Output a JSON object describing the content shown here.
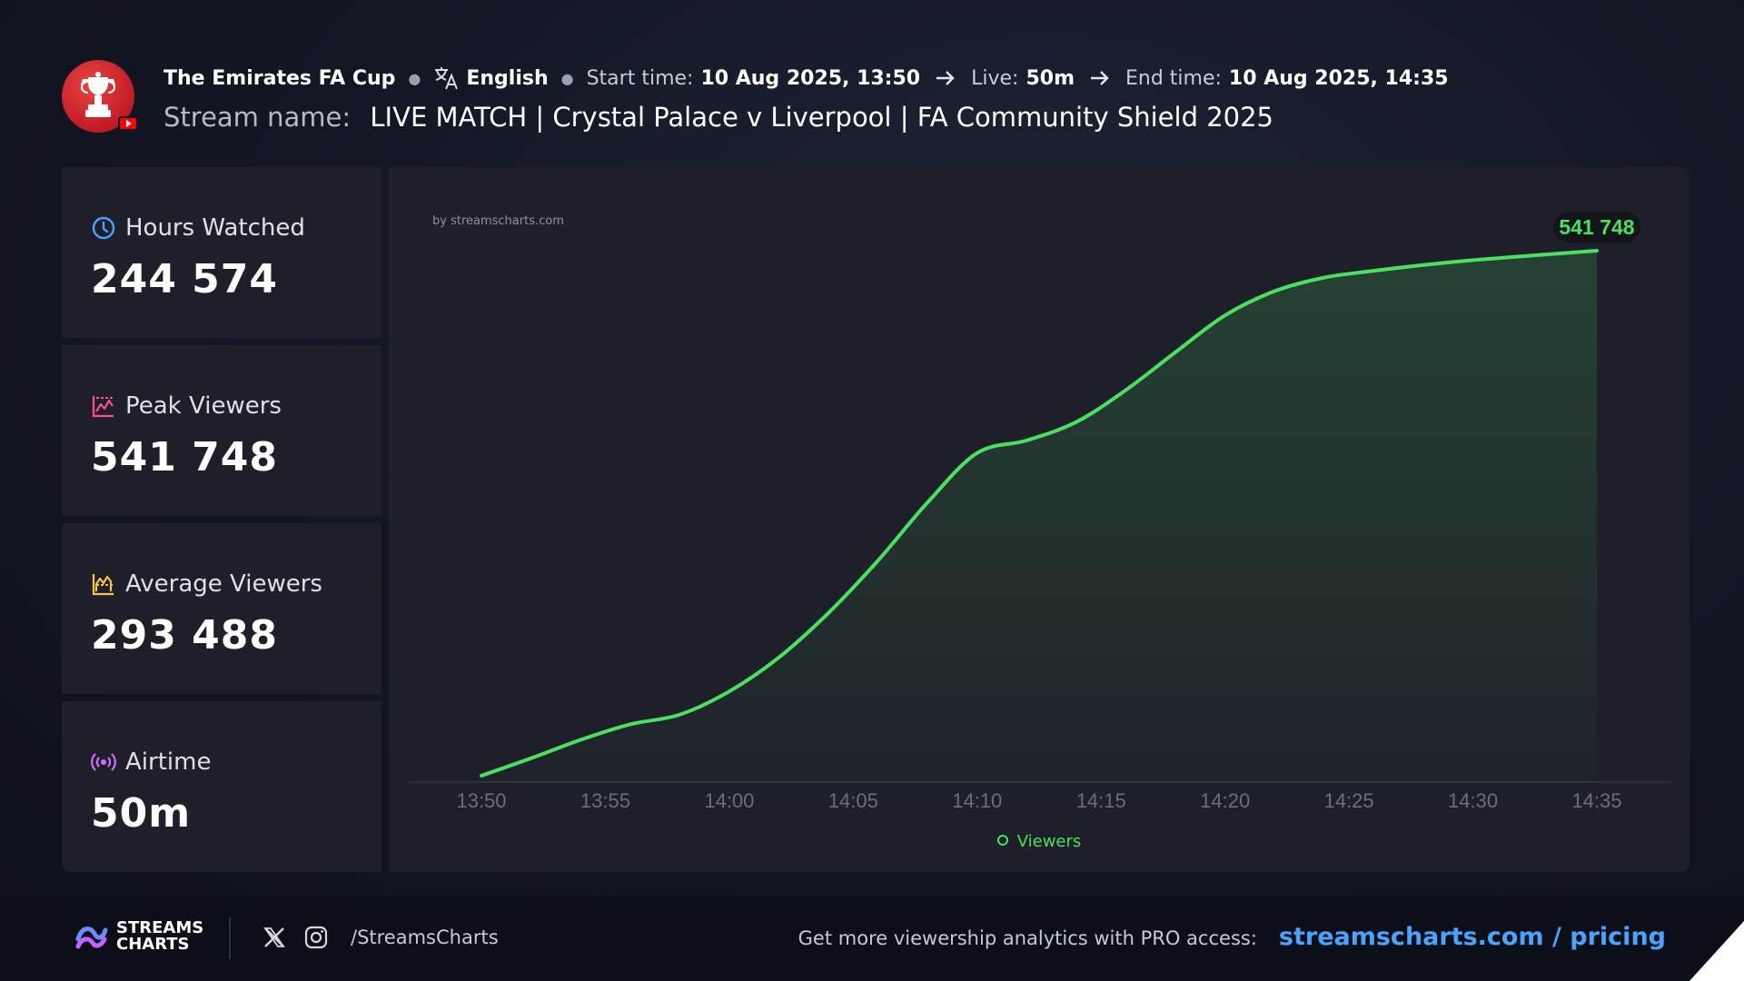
{
  "header": {
    "channel": "The Emirates FA Cup",
    "language": "English",
    "start_label": "Start time:",
    "start_value": "10 Aug 2025, 13:50",
    "live_label": "Live:",
    "live_value": "50m",
    "end_label": "End time:",
    "end_value": "10 Aug 2025, 14:35",
    "stream_label": "Stream name:",
    "stream_value": "LIVE MATCH | Crystal Palace v Liverpool | FA Community Shield 2025"
  },
  "stats": {
    "hours_watched": {
      "label": "Hours Watched",
      "value": "244 574",
      "icon": "clock-icon",
      "color": "#4aa3ff"
    },
    "peak_viewers": {
      "label": "Peak Viewers",
      "value": "541 748",
      "icon": "peak-chart-icon",
      "color": "#ff4d8d"
    },
    "average_viewers": {
      "label": "Average Viewers",
      "value": "293 488",
      "icon": "average-chart-icon",
      "color": "#f5c542"
    },
    "airtime": {
      "label": "Airtime",
      "value": "50m",
      "icon": "broadcast-icon",
      "color": "#d36bff"
    }
  },
  "chart_data": {
    "type": "area",
    "watermark": "by streamscharts.com",
    "x": [
      "13:50",
      "13:52",
      "13:54",
      "13:56",
      "13:58",
      "14:00",
      "14:02",
      "14:04",
      "14:06",
      "14:08",
      "14:10",
      "14:12",
      "14:14",
      "14:16",
      "14:18",
      "14:20",
      "14:22",
      "14:24",
      "14:26",
      "14:28",
      "14:30",
      "14:32",
      "14:35"
    ],
    "series": [
      {
        "name": "Viewers",
        "color": "#4ce063",
        "values": [
          0,
          18000,
          37000,
          53000,
          63000,
          87000,
          122000,
          168000,
          222000,
          282000,
          333000,
          346000,
          365000,
          398000,
          437000,
          475000,
          500000,
          514000,
          521000,
          527000,
          532000,
          536000,
          541748
        ]
      }
    ],
    "peak_label": "541 748",
    "xticks": [
      "13:50",
      "13:55",
      "14:00",
      "14:05",
      "14:10",
      "14:15",
      "14:20",
      "14:25",
      "14:30",
      "14:35"
    ],
    "legend": "Viewers",
    "ylim": [
      0,
      541748
    ],
    "grid": false,
    "colors": {
      "line": "#4ce063",
      "fill": "#4ce063",
      "panel": "#1e1f29",
      "tick": "#6b6f7b"
    }
  },
  "footer": {
    "brand": [
      "STREAMS",
      "CHARTS"
    ],
    "handle": "/StreamsCharts",
    "cta_text": "Get more viewership analytics with PRO access:",
    "cta_link": "streamscharts.com / pricing"
  }
}
